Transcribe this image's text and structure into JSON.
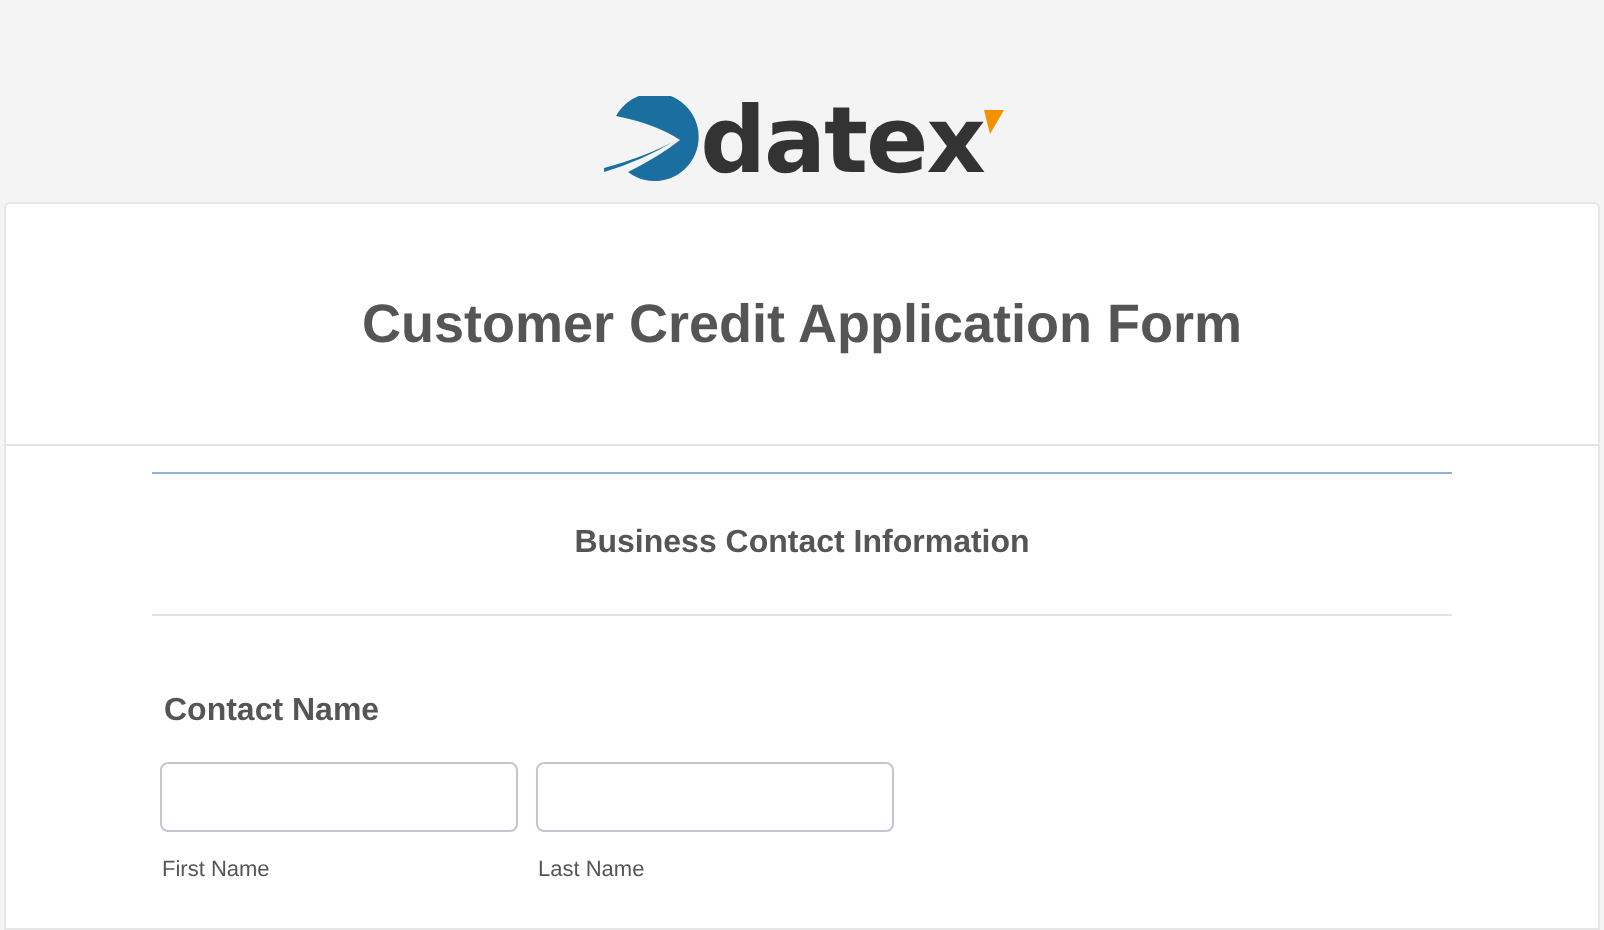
{
  "logo": {
    "text": "datex"
  },
  "title": "Customer Credit Application Form",
  "section": {
    "heading": "Business Contact Information"
  },
  "fields": [
    {
      "label": "Contact Name",
      "inputs": [
        {
          "sublabel": "First Name"
        },
        {
          "sublabel": "Last Name"
        }
      ]
    }
  ]
}
